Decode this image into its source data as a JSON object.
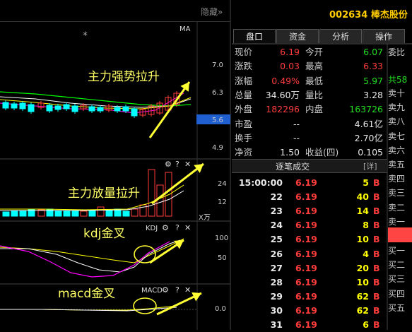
{
  "window": {
    "hide_label": "隐藏",
    "hide_chevron": "»"
  },
  "stock": {
    "code": "002634",
    "name": "棒杰股份"
  },
  "tabs": [
    {
      "label": "盘口",
      "active": true
    },
    {
      "label": "资金",
      "active": false
    },
    {
      "label": "分析",
      "active": false
    },
    {
      "label": "操作",
      "active": false
    }
  ],
  "quote": {
    "rows": [
      {
        "l1": "现价",
        "v1": "6.19",
        "c1": "red",
        "l2": "今开",
        "v2": "6.07",
        "c2": "green"
      },
      {
        "l1": "涨跌",
        "v1": "0.03",
        "c1": "red",
        "l2": "最高",
        "v2": "6.33",
        "c2": "red"
      },
      {
        "l1": "涨幅",
        "v1": "0.49%",
        "c1": "red",
        "l2": "最低",
        "v2": "5.97",
        "c2": "green"
      },
      {
        "l1": "总量",
        "v1": "34.60万",
        "c1": "white",
        "l2": "量比",
        "v2": "3.28",
        "c2": "white"
      },
      {
        "l1": "外盘",
        "v1": "182296",
        "c1": "red",
        "l2": "内盘",
        "v2": "163726",
        "c2": "green"
      },
      {
        "l1": "市盈",
        "v1": "--",
        "c1": "white",
        "l2": "",
        "v2": "4.61亿",
        "c2": "white"
      },
      {
        "l1": "换手",
        "v1": "--",
        "c1": "white",
        "l2": "",
        "v2": "2.70亿",
        "c2": "white"
      },
      {
        "l1": "净资",
        "v1": "1.50",
        "c1": "white",
        "l2": "收益(四)",
        "v2": "0.105",
        "c2": "white"
      }
    ]
  },
  "order_book": {
    "committee_label": "委比",
    "sell_labels": [
      "卖十",
      "卖九",
      "卖八",
      "卖七",
      "卖六",
      "卖五",
      "卖四",
      "卖三",
      "卖二",
      "卖一"
    ],
    "buy_labels": [
      "买一",
      "买二",
      "买三",
      "买四",
      "买五"
    ],
    "total_label": "共58"
  },
  "ticks": {
    "header": "逐笔成交",
    "detail_label": "[详]",
    "rows": [
      {
        "time": "15:00:00",
        "price": "6.19",
        "vol": "5",
        "side": "B"
      },
      {
        "time": "22",
        "price": "6.19",
        "vol": "40",
        "side": "B"
      },
      {
        "time": "23",
        "price": "6.19",
        "vol": "14",
        "side": "B"
      },
      {
        "time": "24",
        "price": "6.19",
        "vol": "8",
        "side": "B"
      },
      {
        "time": "25",
        "price": "6.19",
        "vol": "10",
        "side": "B"
      },
      {
        "time": "26",
        "price": "6.19",
        "vol": "4",
        "side": "B"
      },
      {
        "time": "27",
        "price": "6.19",
        "vol": "20",
        "side": "B"
      },
      {
        "time": "28",
        "price": "6.19",
        "vol": "10",
        "side": "B"
      },
      {
        "time": "29",
        "price": "6.19",
        "vol": "62",
        "side": "B"
      },
      {
        "time": "30",
        "price": "6.19",
        "vol": "62",
        "side": "B"
      },
      {
        "time": "31",
        "price": "6.19",
        "vol": "6",
        "side": "B"
      }
    ]
  },
  "chart": {
    "ma_label": "MA",
    "price_axis": [
      "7.0",
      "6.3",
      "5.6",
      "4.9"
    ],
    "volume_axis": [
      "24",
      "12"
    ],
    "volume_unit": "X万",
    "kdj_label": "KDJ",
    "kdj_axis": [
      "100",
      "50"
    ],
    "macd_label": "MACD",
    "macd_axis": [
      "0.0"
    ],
    "icons": {
      "settings": "⚙",
      "help": "?",
      "close": "✕"
    },
    "colors": {
      "up": "#ff3c3c",
      "down": "#00ffff",
      "ma1": "#ffffff",
      "ma2": "#ffff00",
      "ma3": "#ff00ff",
      "ma4": "#00ff00"
    }
  },
  "annotations": {
    "price": "主力强势拉升",
    "volume": "主力放量拉升",
    "kdj": "kdj金叉",
    "macd": "macd金叉"
  }
}
